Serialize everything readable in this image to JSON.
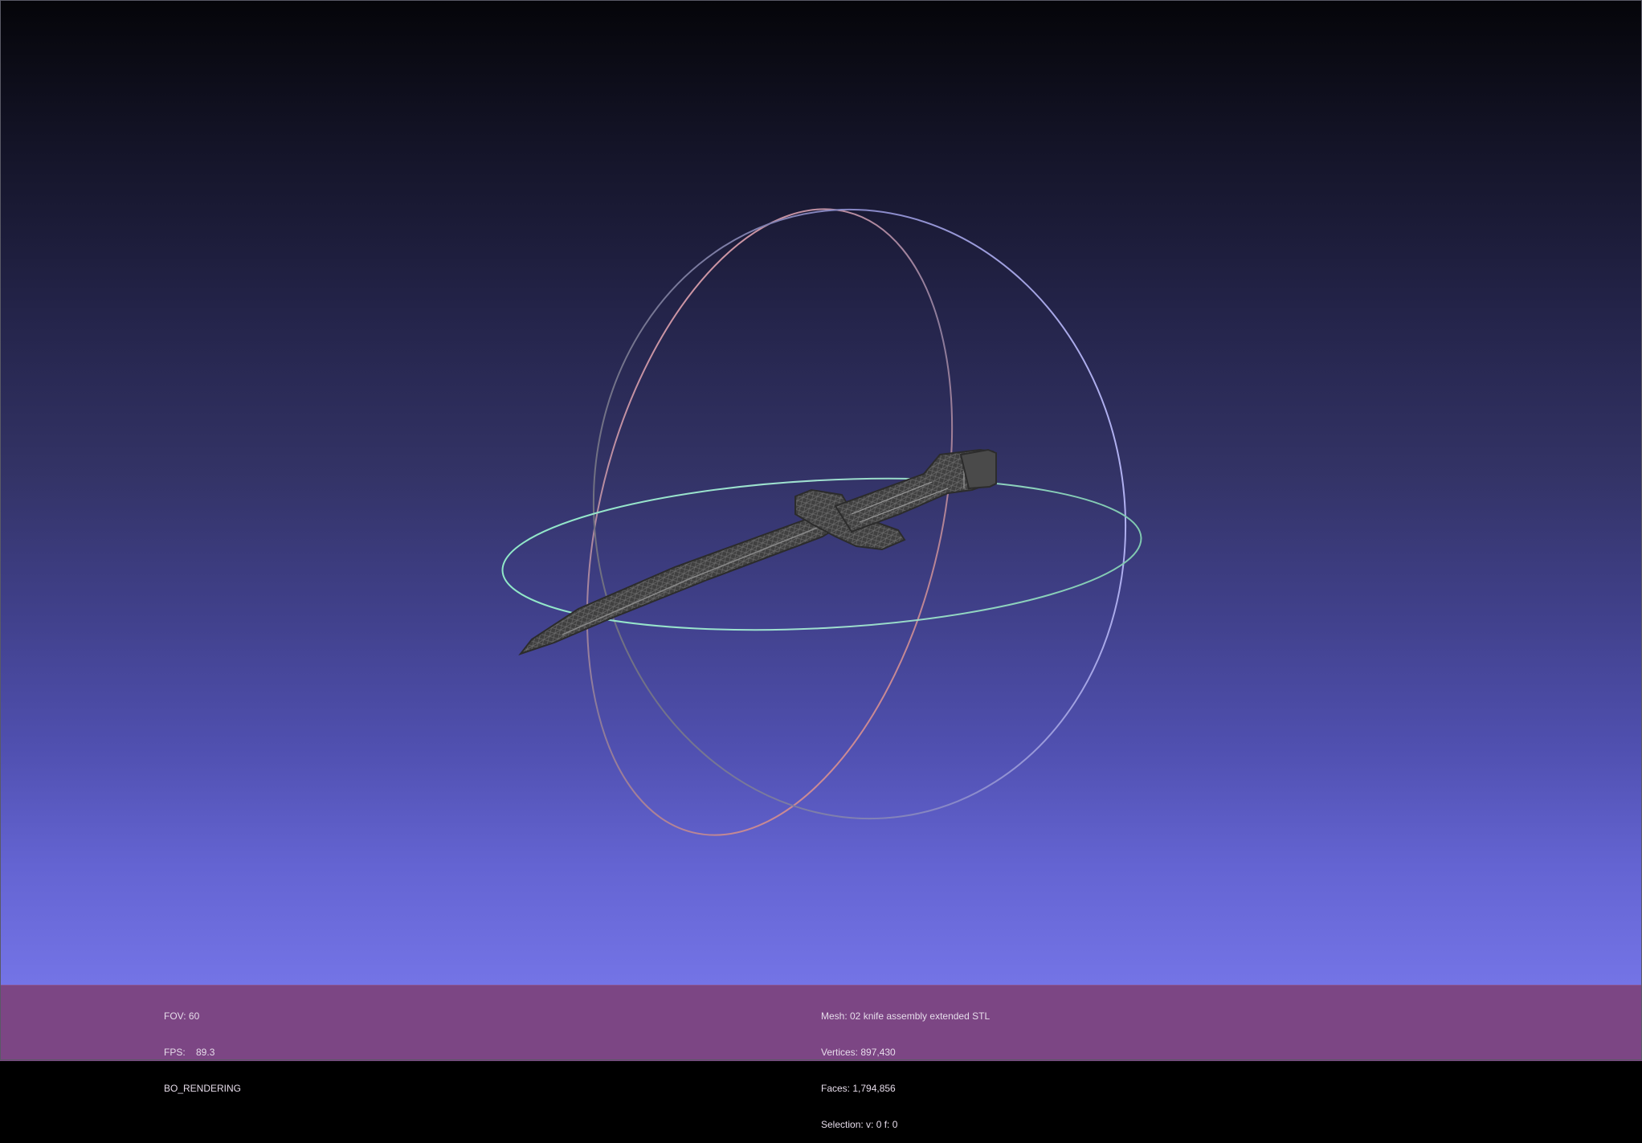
{
  "viewer": {
    "colors": {
      "background_top": "#050509",
      "background_bottom": "#7474e6",
      "info_bar": "#7c4684",
      "info_text": "#e6dcea",
      "mesh": "#3a3a3a",
      "trackball_x": "#e89090",
      "trackball_y": "#9a9ae8",
      "trackball_z": "#90e0c0"
    },
    "icons": [
      "trackball-icon"
    ]
  },
  "info_left": {
    "fov": "FOV: 60",
    "fps": "FPS:    89.3",
    "mode": "BO_RENDERING"
  },
  "info_right": {
    "mesh": "Mesh: 02 knife assembly extended STL",
    "vertices": "Vertices: 897,430",
    "faces": "Faces: 1,794,856",
    "selection": "Selection: v: 0 f: 0"
  }
}
